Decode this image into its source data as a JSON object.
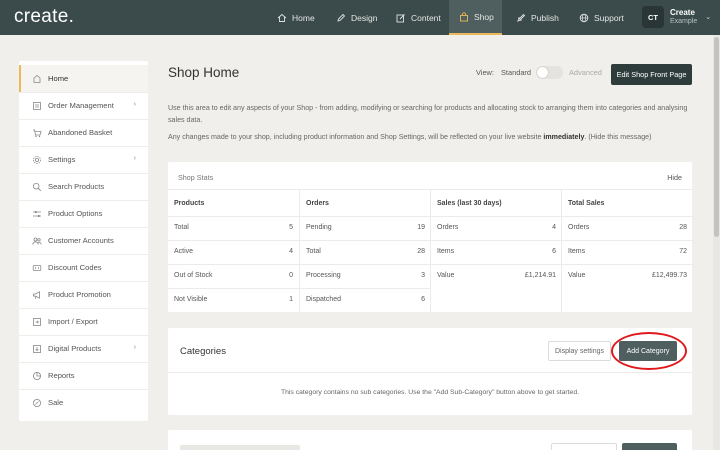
{
  "app": {
    "logo": "create.",
    "nav": [
      {
        "label": "Home",
        "icon": "home-icon"
      },
      {
        "label": "Design",
        "icon": "pencil-icon"
      },
      {
        "label": "Content",
        "icon": "edit-icon"
      },
      {
        "label": "Shop",
        "icon": "shop-icon",
        "active": true
      },
      {
        "label": "Publish",
        "icon": "rocket-icon"
      },
      {
        "label": "Support",
        "icon": "globe-icon"
      }
    ],
    "account": {
      "initials": "CT",
      "name": "Create",
      "sub": "Example"
    },
    "accent": "#e9b95a"
  },
  "sidebar": {
    "items": [
      {
        "label": "Home",
        "icon": "home-icon",
        "active": true
      },
      {
        "label": "Order Management",
        "icon": "orders-icon",
        "chevron": true
      },
      {
        "label": "Abandoned Basket",
        "icon": "basket-icon"
      },
      {
        "label": "Settings",
        "icon": "gear-icon",
        "chevron": true
      },
      {
        "label": "Search Products",
        "icon": "search-icon"
      },
      {
        "label": "Product Options",
        "icon": "sliders-icon"
      },
      {
        "label": "Customer Accounts",
        "icon": "users-icon"
      },
      {
        "label": "Discount Codes",
        "icon": "tag-icon"
      },
      {
        "label": "Product Promotion",
        "icon": "megaphone-icon"
      },
      {
        "label": "Import / Export",
        "icon": "import-export-icon"
      },
      {
        "label": "Digital Products",
        "icon": "download-icon",
        "chevron": true
      },
      {
        "label": "Reports",
        "icon": "chart-icon"
      },
      {
        "label": "Sale",
        "icon": "sale-icon"
      }
    ]
  },
  "main": {
    "title": "Shop Home",
    "view_label": "View:",
    "view_standard": "Standard",
    "view_advanced": "Advanced",
    "edit_front_button": "Edit Shop Front Page",
    "intro": "Use this area to edit any aspects of your Shop - from adding, modifying or searching for products and allocating stock to arranging them into categories and analysing sales data.",
    "notice_prefix": "Any changes made to your shop, including product information and Shop Settings, will be reflected on your live website ",
    "notice_bold": "immediately",
    "notice_suffix": ". (Hide this message)"
  },
  "stats": {
    "title": "Shop Stats",
    "hide": "Hide",
    "columns": [
      {
        "heading": "Products",
        "rows": [
          {
            "label": "Total",
            "value": "5"
          },
          {
            "label": "Active",
            "value": "4"
          },
          {
            "label": "Out of Stock",
            "value": "0"
          },
          {
            "label": "Not Visible",
            "value": "1"
          }
        ]
      },
      {
        "heading": "Orders",
        "rows": [
          {
            "label": "Pending",
            "value": "19"
          },
          {
            "label": "Total",
            "value": "28"
          },
          {
            "label": "Processing",
            "value": "3"
          },
          {
            "label": "Dispatched",
            "value": "6"
          }
        ]
      },
      {
        "heading": "Sales (last 30 days)",
        "rows": [
          {
            "label": "Orders",
            "value": "4"
          },
          {
            "label": "Items",
            "value": "6"
          },
          {
            "label": "Value",
            "value": "£1,214.91"
          }
        ]
      },
      {
        "heading": "Total Sales",
        "rows": [
          {
            "label": "Orders",
            "value": "28"
          },
          {
            "label": "Items",
            "value": "72"
          },
          {
            "label": "Value",
            "value": "£12,499.73"
          }
        ]
      }
    ]
  },
  "categories": {
    "title": "Categories",
    "display_settings": "Display settings",
    "add_category": "Add Category",
    "empty_message": "This category contains no sub categories. Use the \"Add Sub-Category\" button above to get started."
  }
}
